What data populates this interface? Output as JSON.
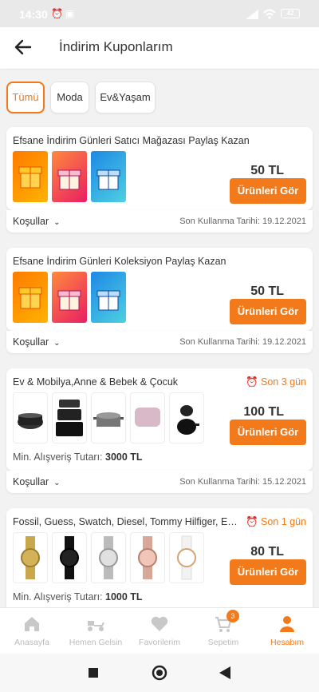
{
  "statusbar": {
    "time": "14:30",
    "battery": "42"
  },
  "header": {
    "title": "İndirim Kuponlarım"
  },
  "filters": [
    "Tümü",
    "Moda",
    "Ev&Yaşam"
  ],
  "coupons": [
    {
      "title": "Efsane İndirim Günleri Satıcı Mağazası Paylaş Kazan",
      "amount": "50 TL",
      "button": "Ürünleri Gör",
      "conditions": "Koşullar",
      "expiry": "Son Kullanma Tarihi: 19.12.2021"
    },
    {
      "title": "Efsane İndirim Günleri Koleksiyon Paylaş Kazan",
      "amount": "50 TL",
      "button": "Ürünleri Gör",
      "conditions": "Koşullar",
      "expiry": "Son Kullanma Tarihi: 19.12.2021"
    },
    {
      "title": "Ev & Mobilya,Anne & Bebek & Çocuk",
      "urgency": "Son 3 gün",
      "amount": "100 TL",
      "button": "Ürünleri Gör",
      "min_label": "Min. Alışveriş Tutarı:",
      "min_value": "3000 TL",
      "conditions": "Koşullar",
      "expiry": "Son Kullanma Tarihi: 15.12.2021"
    },
    {
      "title": "Fossil, Guess, Swatch, Diesel, Tommy Hilfiger,  Empo...",
      "urgency": "Son 1 gün",
      "amount": "80 TL",
      "button": "Ürünleri Gör",
      "min_label": "Min. Alışveriş Tutarı:",
      "min_value": "1000 TL"
    }
  ],
  "tabbar": [
    {
      "label": "Anasayfa",
      "icon": "home-icon"
    },
    {
      "label": "Hemen Gelsin",
      "icon": "scooter-icon"
    },
    {
      "label": "Favorilerim",
      "icon": "heart-icon"
    },
    {
      "label": "Sepetim",
      "icon": "cart-icon",
      "badge": "3"
    },
    {
      "label": "Hesabım",
      "icon": "user-icon",
      "active": true
    }
  ],
  "colors": {
    "accent": "#f27a1a"
  }
}
